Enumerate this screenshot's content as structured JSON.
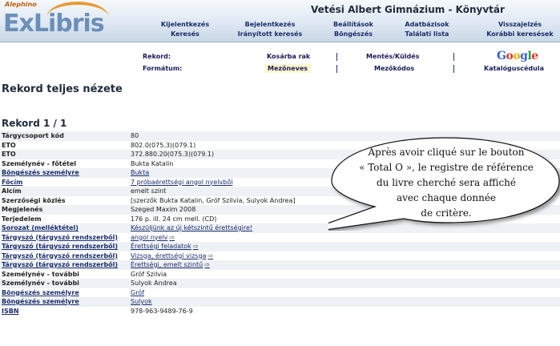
{
  "header": {
    "brand_small": "Alephino",
    "brand": "ExLibris",
    "library_name": "Vetési Albert Gimnázium - Könyvtár",
    "nav": [
      {
        "top": "Kijelentkezés",
        "bottom": "Keresés"
      },
      {
        "top": "Bejelentkezés",
        "bottom": "Irányított keresés"
      },
      {
        "top": "Beállítások",
        "bottom": "Böngészés"
      },
      {
        "top": "Adatbázisok",
        "bottom": "Találati lista"
      },
      {
        "top": "Visszajelzés",
        "bottom": "Korábbi keresések"
      }
    ]
  },
  "toolbar": {
    "rekord_label": "Rekord:",
    "formatum_label": "Formátum:",
    "kosarba": "Kosárba rak",
    "mentes": "Mentés/Küldés",
    "mezoneves": "Mezőneves",
    "mezokodos": "Mezőkódos",
    "katalogus": "Katalóguscédula",
    "google": "Google"
  },
  "main": {
    "page_title": "Rekord teljes nézete",
    "record_number": "Rekord 1 / 1",
    "rows": [
      {
        "key": "Tárgycsoport kód",
        "value": "80",
        "key_link": false,
        "val_link": false,
        "arrow": false
      },
      {
        "key": "ETO",
        "value": "802.0(075.3)(079.1)",
        "key_link": false,
        "val_link": false,
        "arrow": false
      },
      {
        "key": "ETO",
        "value": "372.880.20(075.3)(079.1)",
        "key_link": false,
        "val_link": false,
        "arrow": false
      },
      {
        "key": "Személynév - főtétel",
        "value": "Bukta Katalin",
        "key_link": false,
        "val_link": false,
        "arrow": false
      },
      {
        "key": "Böngészés személyre",
        "value": "Bukta",
        "key_link": true,
        "val_link": true,
        "arrow": false
      },
      {
        "key": "Főcím",
        "value": "7 próbaérettségi angol nyelvből",
        "key_link": true,
        "val_link": true,
        "arrow": false
      },
      {
        "key": "Alcím",
        "value": "emelt szint",
        "key_link": false,
        "val_link": false,
        "arrow": false
      },
      {
        "key": "Szerzőségi közlés",
        "value": "[szerzők Bukta Katalin, Gróf Szilvia, Sulyok Andrea]",
        "key_link": false,
        "val_link": false,
        "arrow": false
      },
      {
        "key": "Megjelenés",
        "value": "Szeged Maxim 2008",
        "key_link": false,
        "val_link": false,
        "arrow": false
      },
      {
        "key": "Terjedelem",
        "value": "176 p. ill. 24 cm mell. (CD)",
        "key_link": false,
        "val_link": false,
        "arrow": false
      },
      {
        "key": "Sorozat (melléktétel)",
        "value": "Készüljünk az új kétszintű érettségire!",
        "key_link": true,
        "val_link": true,
        "arrow": false
      },
      {
        "key": "Tárgyszó (tárgyszó rendszerből)",
        "value": "angol nyelv",
        "key_link": true,
        "val_link": true,
        "arrow": true
      },
      {
        "key": "Tárgyszó (tárgyszó rendszerből)",
        "value": "Érettségi feladatok",
        "key_link": true,
        "val_link": true,
        "arrow": true
      },
      {
        "key": "Tárgyszó (tárgyszó rendszerből)",
        "value": "Vizsga, érettségi vizsga",
        "key_link": true,
        "val_link": true,
        "arrow": true
      },
      {
        "key": "Tárgyszó (tárgyszó rendszerből)",
        "value": "Érettségi, emelt szintű",
        "key_link": true,
        "val_link": true,
        "arrow": true
      },
      {
        "key": "Személynév - további",
        "value": "Gróf Szilvia",
        "key_link": false,
        "val_link": false,
        "arrow": false
      },
      {
        "key": "Személynév - további",
        "value": "Sulyok Andrea",
        "key_link": false,
        "val_link": false,
        "arrow": false
      },
      {
        "key": "Böngészés személyre",
        "value": "Gróf",
        "key_link": true,
        "val_link": true,
        "arrow": false
      },
      {
        "key": "Böngészés személyre",
        "value": "Sulyok",
        "key_link": true,
        "val_link": true,
        "arrow": false
      },
      {
        "key": "ISBN",
        "value": "978-963-9489-76-9",
        "key_link": true,
        "val_link": false,
        "arrow": false
      }
    ]
  },
  "callout": {
    "lines": [
      "Après avoir cliqué sur le bouton",
      "« Total O », le registre de référence",
      "du livre cherché sera affiché",
      "avec chaque donnée",
      "de critère."
    ]
  }
}
